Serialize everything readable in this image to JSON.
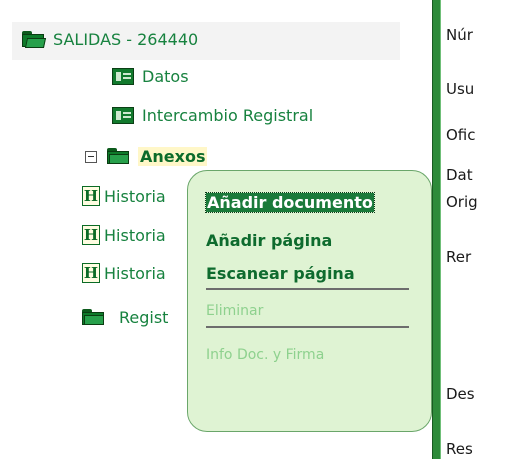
{
  "tree": {
    "root": {
      "label": "SALIDAS - 264440",
      "icon": "open-folder-icon"
    },
    "datos": {
      "label": "Datos",
      "icon": "form-icon"
    },
    "intercambio": {
      "label": "Intercambio Registral",
      "icon": "form-icon"
    },
    "anexos": {
      "label": "Anexos",
      "expander": "minus",
      "icon": "folder-icon"
    },
    "historia_1": {
      "label": "Historia",
      "icon": "h-document-icon"
    },
    "historia_2": {
      "label": "Historia",
      "icon": "h-document-icon"
    },
    "historia_3": {
      "label": "Historia",
      "icon": "h-document-icon"
    },
    "registro": {
      "label": "Regist",
      "icon": "folder-icon"
    }
  },
  "context_menu": {
    "items": [
      {
        "label": "Añadir documento",
        "state": "selected"
      },
      {
        "label": "Añadir página",
        "state": "enabled"
      },
      {
        "label": "Escanear página",
        "state": "enabled"
      },
      {
        "label": "Eliminar",
        "state": "disabled"
      },
      {
        "label": "Info Doc. y Firma",
        "state": "disabled"
      }
    ]
  },
  "detail_labels": [
    "Núr",
    "Usu",
    "Ofic",
    "Dat",
    "Orig",
    "Rer",
    "Des",
    "Res"
  ],
  "colors": {
    "accent": "#17823f",
    "menu_bg": "#dff3d3",
    "divider": "#2e8b3a"
  }
}
